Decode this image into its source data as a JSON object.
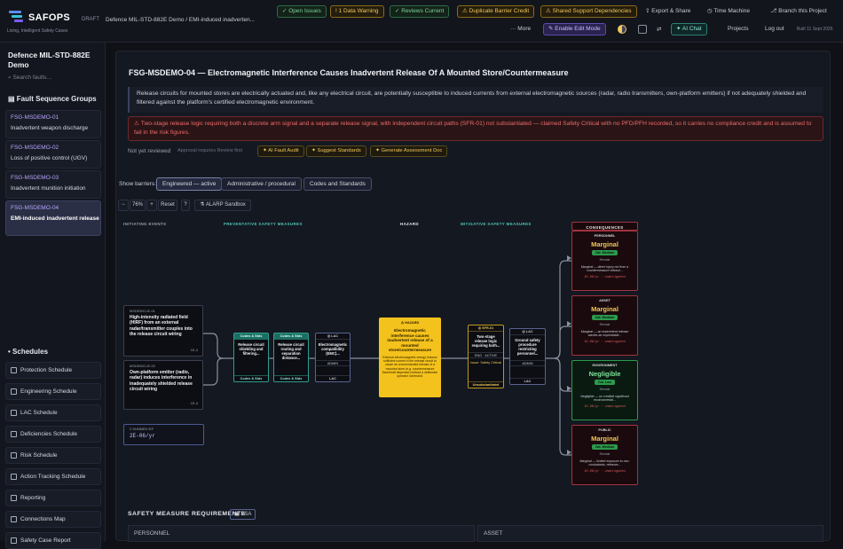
{
  "app": {
    "logo_text": "SAFOPS",
    "tagline": "Living, Intelligent Safety Cases",
    "draft_label": "DRAFT",
    "breadcrumb": "Defence MIL-STD-882E Demo / EMI-induced inadverten...",
    "build": "Built 11 Sept 2026"
  },
  "chips": {
    "open_issues": "✓ Open Issues",
    "data_warning": "! 1 Data Warning",
    "reviews_current": "✓ Reviews Current",
    "duplicate_barrier": "⚠ Duplicate Barrier Credit",
    "shared_support": "⚠ Shared Support Dependencies"
  },
  "toolbar": {
    "export_share": "Export & Share",
    "time_machine": "Time Machine",
    "branch": "Branch this Project",
    "more": "··· More",
    "enable_edit": "✎ Enable Edit Mode",
    "ai_chat": "✦ AI Chat",
    "projects": "Projects",
    "logout": "Log out"
  },
  "sidebar": {
    "project_title": "Defence MIL-STD-882E Demo",
    "search_placeholder": "Search faults...",
    "fault_sequence_groups": "Fault Sequence Groups",
    "fsgs": [
      {
        "code": "FSG-MSDEMO-01",
        "name": "Inadvertent weapon discharge"
      },
      {
        "code": "FSG-MSDEMO-02",
        "name": "Loss of positive control (UGV)"
      },
      {
        "code": "FSG-MSDEMO-03",
        "name": "Inadvertent munition initiation"
      },
      {
        "code": "FSG-MSDEMO-04",
        "name": "EMI-induced inadvertent release"
      }
    ],
    "schedules_title": "Schedules",
    "schedules": [
      "Protection Schedule",
      "Engineering Schedule",
      "LAC Schedule",
      "Deficiencies Schedule",
      "Risk Schedule",
      "Action Tracking Schedule",
      "Reporting",
      "Connections Map",
      "Safety Case Report"
    ]
  },
  "main": {
    "title": "FSG-MSDEMO-04 — Electromagnetic Interference Causes Inadvertent Release Of A Mounted Store/Countermeasure",
    "description": "Release circuits for mounted stores are electrically actuated and, like any electrical circuit, are potentially susceptible to induced currents from external electromagnetic sources (radar, radio transmitters, own-platform emitters) if not adequately shielded and filtered against the platform's certified electromagnetic environment.",
    "warning": "⚠ Two-stage release logic requiring both a discrete arm signal and a separate release signal, with independent circuit paths (SFR-01) not substantiated — claimed Safety Critical with no PFD/PFH recorded, so it carries no compliance credit and is assumed to fail in the risk figures.",
    "review_status": "Not yet reviewed",
    "review_note": "Approval requires Review first",
    "review_buttons": [
      "✦ AI Fault Audit",
      "✦ Suggest Standards",
      "✦ Generate Assessment Doc"
    ],
    "show_barriers_label": "Show barriers:",
    "barrier_filters": [
      "Engineered — active",
      "Administrative / procedural",
      "Codes and Standards"
    ],
    "zoom": {
      "minus": "−",
      "level": "76%",
      "plus": "+",
      "reset": "Reset",
      "help": "?",
      "alarp": "ALARP Sandbox"
    }
  },
  "diagram": {
    "col_labels": [
      "INITIATING EVENTS",
      "PREVENTATIVE SAFETY MEASURES",
      "HAZARD",
      "MITIGATIVE SAFETY MEASURES",
      "CONSEQUENCES"
    ],
    "events": [
      {
        "id": "MSDEMO-IE-01",
        "text": "High-intensity radiated field (HIRF) from an external radar/transmitter couples into the release circuit wiring",
        "rate": "1E-4"
      },
      {
        "id": "MSDEMO-IE-02",
        "text": "Own-platform emitter (radio, radar) induces interference in inadequately shielded release circuit wiring",
        "rate": "1E-4"
      }
    ],
    "summed": {
      "label": "Σ SUMMED IEF",
      "value": "2E-06/yr"
    },
    "preventative": [
      {
        "head": "Codes & Stds",
        "text": "Release circuit shielding and filtering...",
        "foot": "Codes & Stds"
      },
      {
        "head": "Codes & Stds",
        "text": "Release circuit routing and separation distance...",
        "foot": "Codes & Stds"
      },
      {
        "head": "◎ LAC",
        "text": "Electromagnetic compatibility (EMC)...",
        "mid": "ADMIN",
        "foot": "LAC"
      }
    ],
    "hazard": {
      "label": "⚠ HAZARD",
      "title": "Electromagnetic interference causes inadvertent release of a mounted store/countermeasure",
      "detail": "External electromagnetic energy induces sufficient current in the release circuit to cause an uncommanded release of a mounted store (e.g. countermeasure flare/chaff dispenser) without a deliberate operator command."
    },
    "mitigative": [
      {
        "head": "◎ SFR-01",
        "text": "Two-stage release logic requiring both...",
        "mid": "ENG · ACTIVE",
        "tag": "Issue: Safety Critical",
        "foot": "Unsubstantiated"
      },
      {
        "head": "◎ LAC",
        "text": "Ground safety procedure restricting personnel...",
        "mid": "ADMIN",
        "foot": "LAC"
      }
    ],
    "consequences": [
      {
        "header": "PERSONNEL",
        "severity": "Marginal",
        "pill": "Cat. Medium",
        "remote": "Remote",
        "desc": "Marginal — direct injury not from a countermeasure release...",
        "rate": "1E-06/yr · unmitigated"
      },
      {
        "header": "ASSET",
        "severity": "Marginal",
        "pill": "Cat. Medium",
        "remote": "Remote",
        "desc": "Marginal — an inadvertent release wastes an expendable...",
        "rate": "1E-06/yr · unmitigated"
      },
      {
        "header": "ENVIRONMENT",
        "severity": "Negligible",
        "pill": "Cat. Low",
        "remote": "Remote",
        "desc": "Negligible — no credible significant environmental...",
        "rate": "1E-06/yr · unmitigated"
      },
      {
        "header": "PUBLIC",
        "severity": "Marginal",
        "pill": "Cat. Medium",
        "remote": "Remote",
        "desc": "Marginal — limited exposure to non-combatants, releases...",
        "rate": "1E-06/yr · unmitigated"
      }
    ]
  },
  "requirements": {
    "title": "SAFETY MEASURE REQUIREMENTS",
    "psa": "▣ PSA",
    "columns": [
      "PERSONNEL",
      "ASSET"
    ]
  },
  "colors": {
    "accent": "#6f5cff",
    "hazard": "#f4c21c",
    "danger": "#a33240",
    "ok": "#2c9a4d"
  }
}
